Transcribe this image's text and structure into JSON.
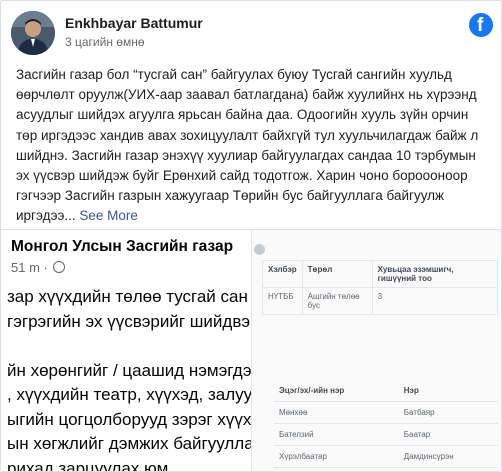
{
  "post": {
    "author": "Enkhbayar Battumur",
    "time": "3 цагийн өмнө",
    "text": "Засгийн газар бол “тусгай сан” байгуулах буюу Тусгай сангийн хуульд өөрчлөлт оруулж(УИХ-аар заавал батлагдана) байж хуулийнх нь хүрээнд асуудлыг шийдэх агуулга ярьсан байна даа. Одоогийн хууль зүйн орчин төр иргэдээс хандив авах зохицуулалт байхгүй тул хуульчилагдаж байж л шийднэ. Засгийн газар энэхүү хуулиар байгуулагдах сандаа 10 тэрбумын эх үүсвэр шийдэж буйг Ерөнхий сайд тодотгож. Харин чоно бороооноор гэгчээр Засгийн газрын хажуугаар Төрийн бус байгууллага байгуулж иргэдээ...",
    "see_more": "See More",
    "logo_letter": "f"
  },
  "shared_post": {
    "page_name": "Монгол Улсын Засгийн газар",
    "time": "51 m ·",
    "lines": [
      "зар хүүхдийн төлөө тусгай сан б",
      "гэгрэгийн эх үүсвэрийг шийдвэр",
      "",
      "йн хөрөнгийг / цаашид нэмэгдэх",
      ", хүүхдийн театр, хүүхэд, залуучу",
      "ыгийн цогцолборууд зэрэг хүүхэд",
      "ын хөгжлийг дэмжих байгууллагу",
      "рихад зарцуулах юм."
    ]
  },
  "document": {
    "table1": {
      "headers": [
        "Хэлбэр",
        "Төрөл",
        "Хувьцаа эзэмшигч, гишүүний тоо"
      ],
      "row": [
        "НҮТББ",
        "Ашгийн төлөө бус",
        "3"
      ]
    },
    "table2": {
      "headers": [
        "Эцэг/эх/-ийн нэр",
        "Нэр"
      ],
      "rows": [
        [
          "Мөнхөө",
          "Батбаяр"
        ],
        [
          "Бателзий",
          "Баатар"
        ],
        [
          "Хүрэлбаатар",
          "Дамдинсүрэн"
        ]
      ]
    }
  },
  "colors": {
    "facebook_blue": "#1877f2",
    "link": "#385898",
    "secondary_text": "#65676b"
  }
}
